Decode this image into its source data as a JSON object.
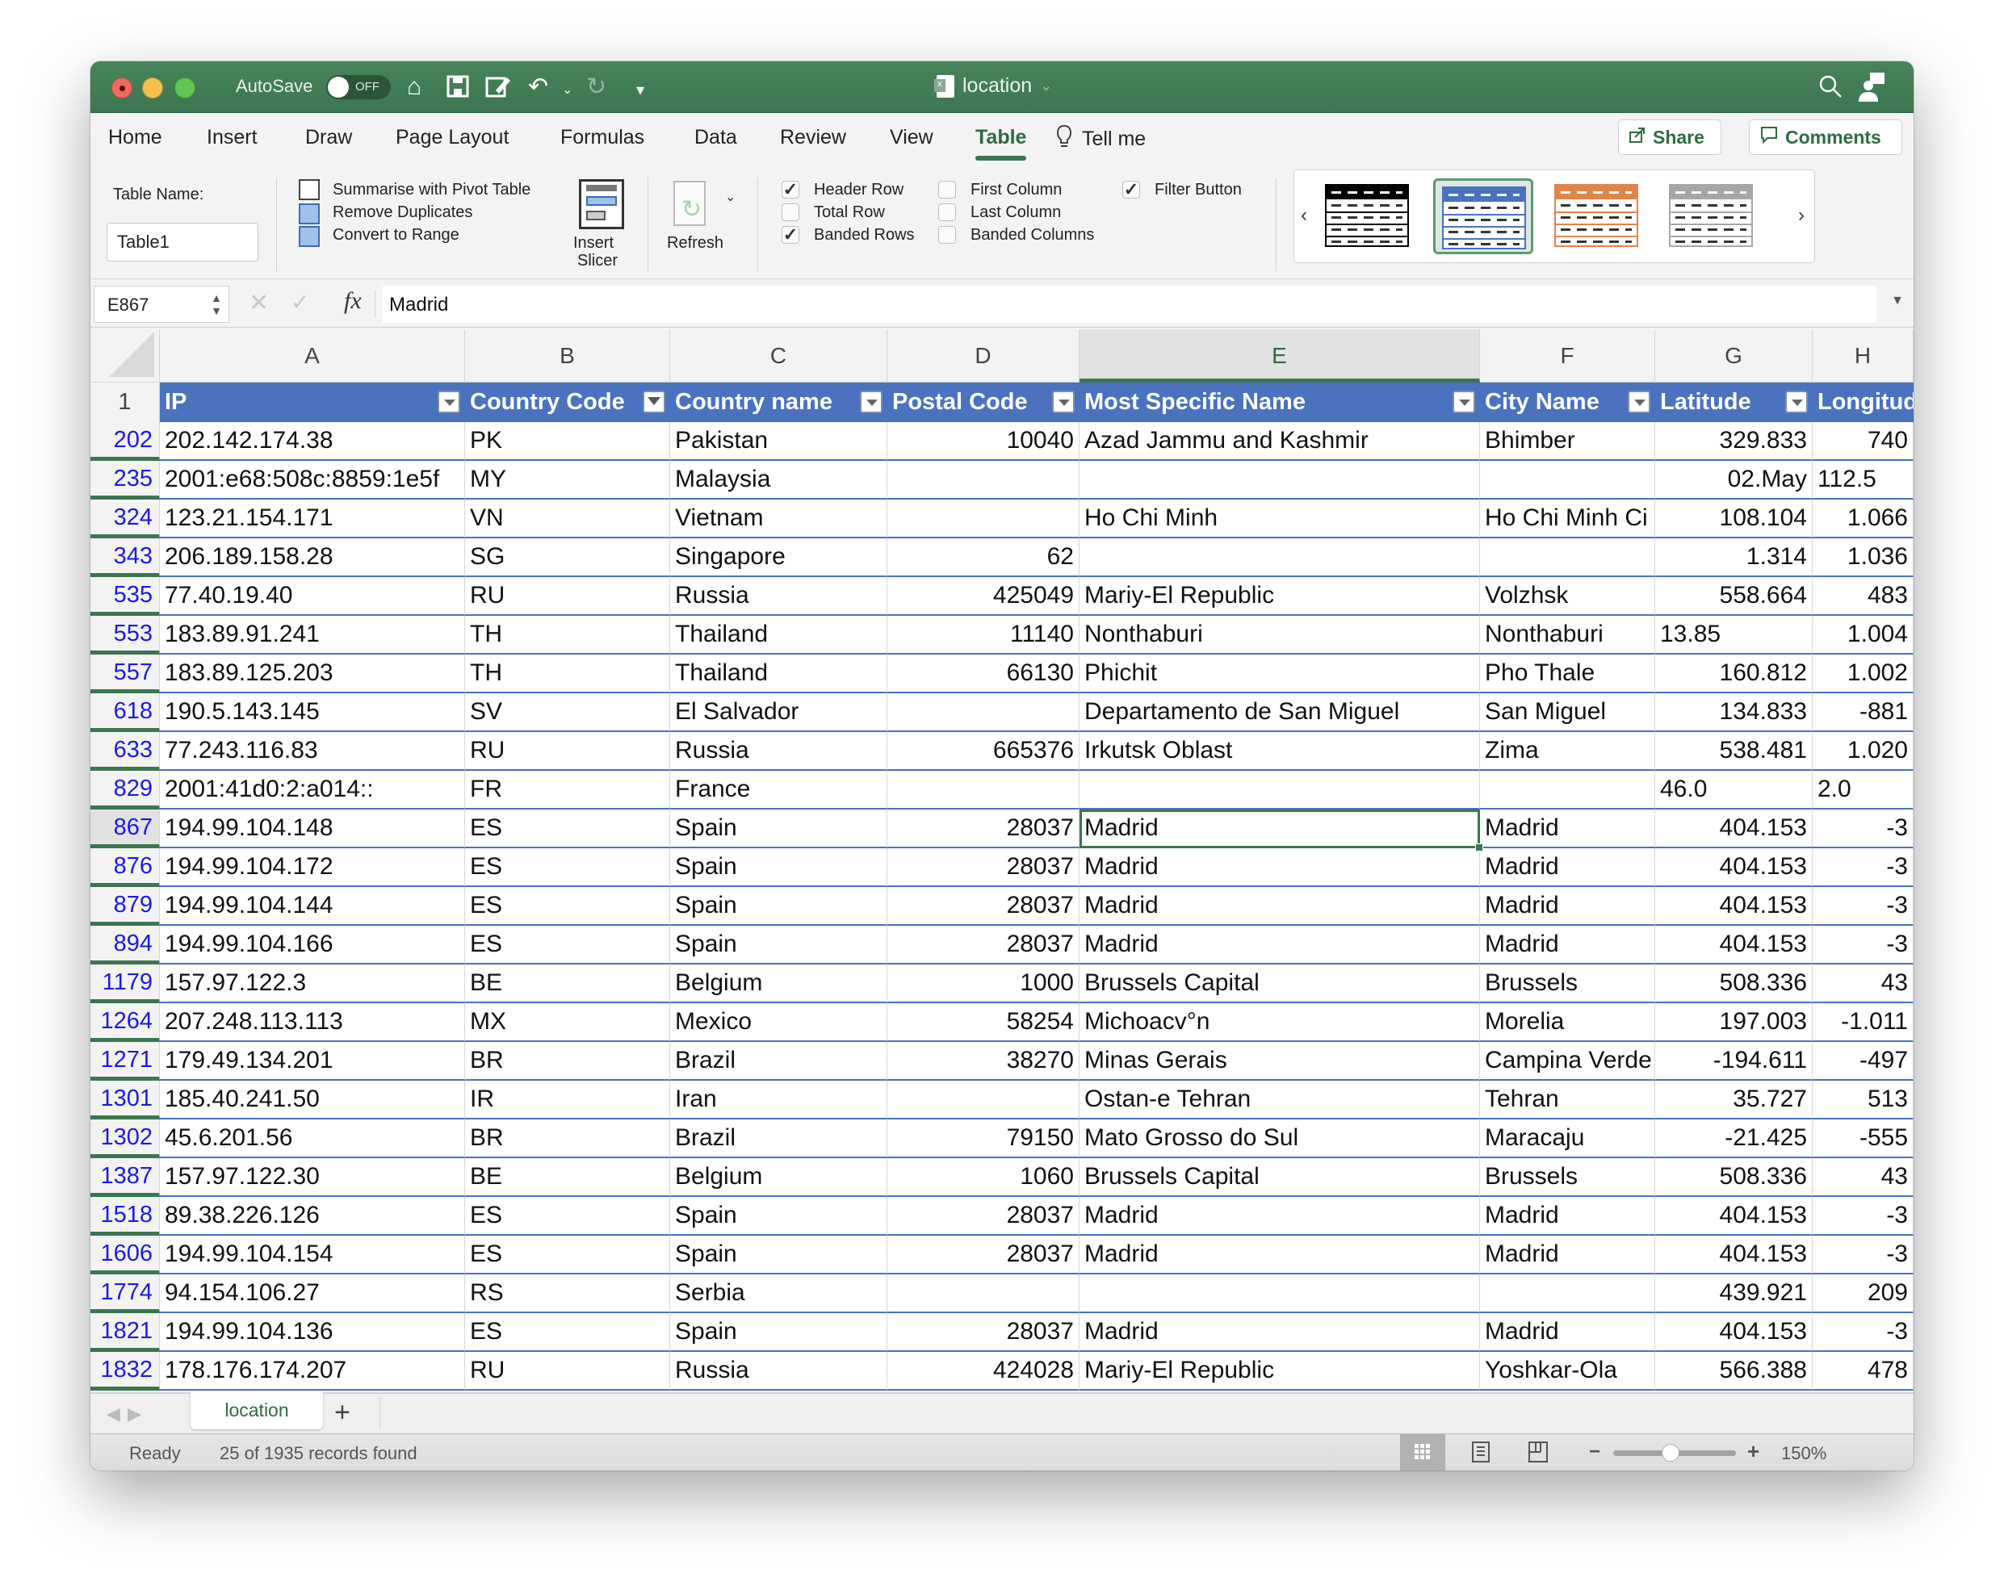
{
  "titlebar": {
    "autosave_label": "AutoSave",
    "autosave_state": "OFF",
    "document_title": "location",
    "icons": [
      "home-icon",
      "save-icon",
      "edit-icon",
      "undo-icon",
      "undo-dropdown-icon",
      "redo-icon",
      "customize-toolbar-icon",
      "search-icon",
      "share-person-icon"
    ]
  },
  "ribbon": {
    "tabs": [
      "Home",
      "Insert",
      "Draw",
      "Page Layout",
      "Formulas",
      "Data",
      "Review",
      "View",
      "Table"
    ],
    "active_tab": "Table",
    "tell_me": "Tell me",
    "share_label": "Share",
    "comments_label": "Comments",
    "table_name_label": "Table Name:",
    "table_name_value": "Table1",
    "tools": {
      "pivot": "Summarise with Pivot Table",
      "remove_duplicates": "Remove Duplicates",
      "convert_range": "Convert to Range",
      "insert_slicer_line1": "Insert",
      "insert_slicer_line2": "Slicer",
      "refresh": "Refresh"
    },
    "options": [
      {
        "label": "Header Row",
        "checked": true
      },
      {
        "label": "Total Row",
        "checked": false
      },
      {
        "label": "Banded Rows",
        "checked": true
      },
      {
        "label": "First Column",
        "checked": false
      },
      {
        "label": "Last Column",
        "checked": false
      },
      {
        "label": "Banded Columns",
        "checked": false
      },
      {
        "label": "Filter Button",
        "checked": true
      }
    ],
    "checkmark": "✓",
    "table_styles": [
      {
        "name": "black",
        "color": "#000000",
        "selected": false
      },
      {
        "name": "blue",
        "color": "#4a72bf",
        "selected": true
      },
      {
        "name": "orange",
        "color": "#e0854a",
        "selected": false
      },
      {
        "name": "gray",
        "color": "#a6a6a6",
        "selected": false
      }
    ],
    "gallery_prev": "‹",
    "gallery_next": "›"
  },
  "formula_bar": {
    "name_box": "E867",
    "cancel_glyph": "✕",
    "enter_glyph": "✓",
    "fx_label": "fx",
    "value": "Madrid"
  },
  "grid": {
    "columns": [
      "A",
      "B",
      "C",
      "D",
      "E",
      "F",
      "G",
      "H"
    ],
    "selected_column": "E",
    "header_row_number": "1",
    "headers": [
      "IP",
      "Country Code",
      "Country name",
      "Postal Code",
      "Most Specific Name",
      "City Name",
      "Latitude",
      "Longitude"
    ],
    "filtered_column": "Country Code",
    "selected_cell": {
      "row": "867",
      "col": "E"
    },
    "rows": [
      {
        "row": "202",
        "cells": [
          "202.142.174.38",
          "PK",
          "Pakistan",
          "10040",
          "Azad Jammu and Kashmir",
          "Bhimber",
          "329.833",
          "740"
        ]
      },
      {
        "row": "235",
        "cells": [
          "2001:e68:508c:8859:1e5f",
          "MY",
          "Malaysia",
          "",
          "",
          "",
          "02.May",
          "112.5"
        ]
      },
      {
        "row": "324",
        "cells": [
          "123.21.154.171",
          "VN",
          "Vietnam",
          "",
          "Ho Chi Minh",
          "Ho Chi Minh Ci",
          "108.104",
          "1.066"
        ]
      },
      {
        "row": "343",
        "cells": [
          "206.189.158.28",
          "SG",
          "Singapore",
          "62",
          "",
          "",
          "1.314",
          "1.036"
        ]
      },
      {
        "row": "535",
        "cells": [
          "77.40.19.40",
          "RU",
          "Russia",
          "425049",
          "Mariy-El Republic",
          "Volzhsk",
          "558.664",
          "483"
        ]
      },
      {
        "row": "553",
        "cells": [
          "183.89.91.241",
          "TH",
          "Thailand",
          "11140",
          "Nonthaburi",
          "Nonthaburi",
          "13.85",
          "1.004"
        ]
      },
      {
        "row": "557",
        "cells": [
          "183.89.125.203",
          "TH",
          "Thailand",
          "66130",
          "Phichit",
          "Pho Thale",
          "160.812",
          "1.002"
        ]
      },
      {
        "row": "618",
        "cells": [
          "190.5.143.145",
          "SV",
          "El Salvador",
          "",
          "Departamento de San Miguel",
          "San Miguel",
          "134.833",
          "-881"
        ]
      },
      {
        "row": "633",
        "cells": [
          "77.243.116.83",
          "RU",
          "Russia",
          "665376",
          "Irkutsk Oblast",
          "Zima",
          "538.481",
          "1.020"
        ]
      },
      {
        "row": "829",
        "cells": [
          "2001:41d0:2:a014::",
          "FR",
          "France",
          "",
          "",
          "",
          "46.0",
          "2.0"
        ]
      },
      {
        "row": "867",
        "cells": [
          "194.99.104.148",
          "ES",
          "Spain",
          "28037",
          "Madrid",
          "Madrid",
          "404.153",
          "-3"
        ]
      },
      {
        "row": "876",
        "cells": [
          "194.99.104.172",
          "ES",
          "Spain",
          "28037",
          "Madrid",
          "Madrid",
          "404.153",
          "-3"
        ]
      },
      {
        "row": "879",
        "cells": [
          "194.99.104.144",
          "ES",
          "Spain",
          "28037",
          "Madrid",
          "Madrid",
          "404.153",
          "-3"
        ]
      },
      {
        "row": "894",
        "cells": [
          "194.99.104.166",
          "ES",
          "Spain",
          "28037",
          "Madrid",
          "Madrid",
          "404.153",
          "-3"
        ]
      },
      {
        "row": "1179",
        "cells": [
          "157.97.122.3",
          "BE",
          "Belgium",
          "1000",
          "Brussels Capital",
          "Brussels",
          "508.336",
          "43"
        ]
      },
      {
        "row": "1264",
        "cells": [
          "207.248.113.113",
          "MX",
          "Mexico",
          "58254",
          "Michoacv°n",
          "Morelia",
          "197.003",
          "-1.011"
        ]
      },
      {
        "row": "1271",
        "cells": [
          "179.49.134.201",
          "BR",
          "Brazil",
          "38270",
          "Minas Gerais",
          "Campina Verde",
          "-194.611",
          "-497"
        ]
      },
      {
        "row": "1301",
        "cells": [
          "185.40.241.50",
          "IR",
          "Iran",
          "",
          "Ostan-e Tehran",
          "Tehran",
          "35.727",
          "513"
        ]
      },
      {
        "row": "1302",
        "cells": [
          "45.6.201.56",
          "BR",
          "Brazil",
          "79150",
          "Mato Grosso do Sul",
          "Maracaju",
          "-21.425",
          "-555"
        ]
      },
      {
        "row": "1387",
        "cells": [
          "157.97.122.30",
          "BE",
          "Belgium",
          "1060",
          "Brussels Capital",
          "Brussels",
          "508.336",
          "43"
        ]
      },
      {
        "row": "1518",
        "cells": [
          "89.38.226.126",
          "ES",
          "Spain",
          "28037",
          "Madrid",
          "Madrid",
          "404.153",
          "-3"
        ]
      },
      {
        "row": "1606",
        "cells": [
          "194.99.104.154",
          "ES",
          "Spain",
          "28037",
          "Madrid",
          "Madrid",
          "404.153",
          "-3"
        ]
      },
      {
        "row": "1774",
        "cells": [
          "94.154.106.27",
          "RS",
          "Serbia",
          "",
          "",
          "",
          "439.921",
          "209"
        ]
      },
      {
        "row": "1821",
        "cells": [
          "194.99.104.136",
          "ES",
          "Spain",
          "28037",
          "Madrid",
          "Madrid",
          "404.153",
          "-3"
        ]
      },
      {
        "row": "1832",
        "cells": [
          "178.176.174.207",
          "RU",
          "Russia",
          "424028",
          "Mariy-El Republic",
          "Yoshkar-Ola",
          "566.388",
          "478"
        ]
      }
    ],
    "left_aligned_numeric_cells": [
      [
        "553",
        6
      ],
      [
        "235",
        7
      ],
      [
        "829",
        6
      ],
      [
        "829",
        7
      ]
    ]
  },
  "sheets": {
    "prev_glyph": "◀",
    "next_glyph": "▶",
    "tabs": [
      "location"
    ],
    "active": "location",
    "add_glyph": "+"
  },
  "status": {
    "ready": "Ready",
    "records": "25 of 1935 records found",
    "active_view": "normal",
    "zoom_minus": "−",
    "zoom_plus": "+",
    "zoom_level": "150%",
    "zoom_slider_fraction": 0.47
  },
  "colors": {
    "titlebar_green": "#3f7e51",
    "table_header_blue": "#4a72bf",
    "row_header_blue": "#1a1ae6",
    "selection_green": "#3b7650"
  }
}
